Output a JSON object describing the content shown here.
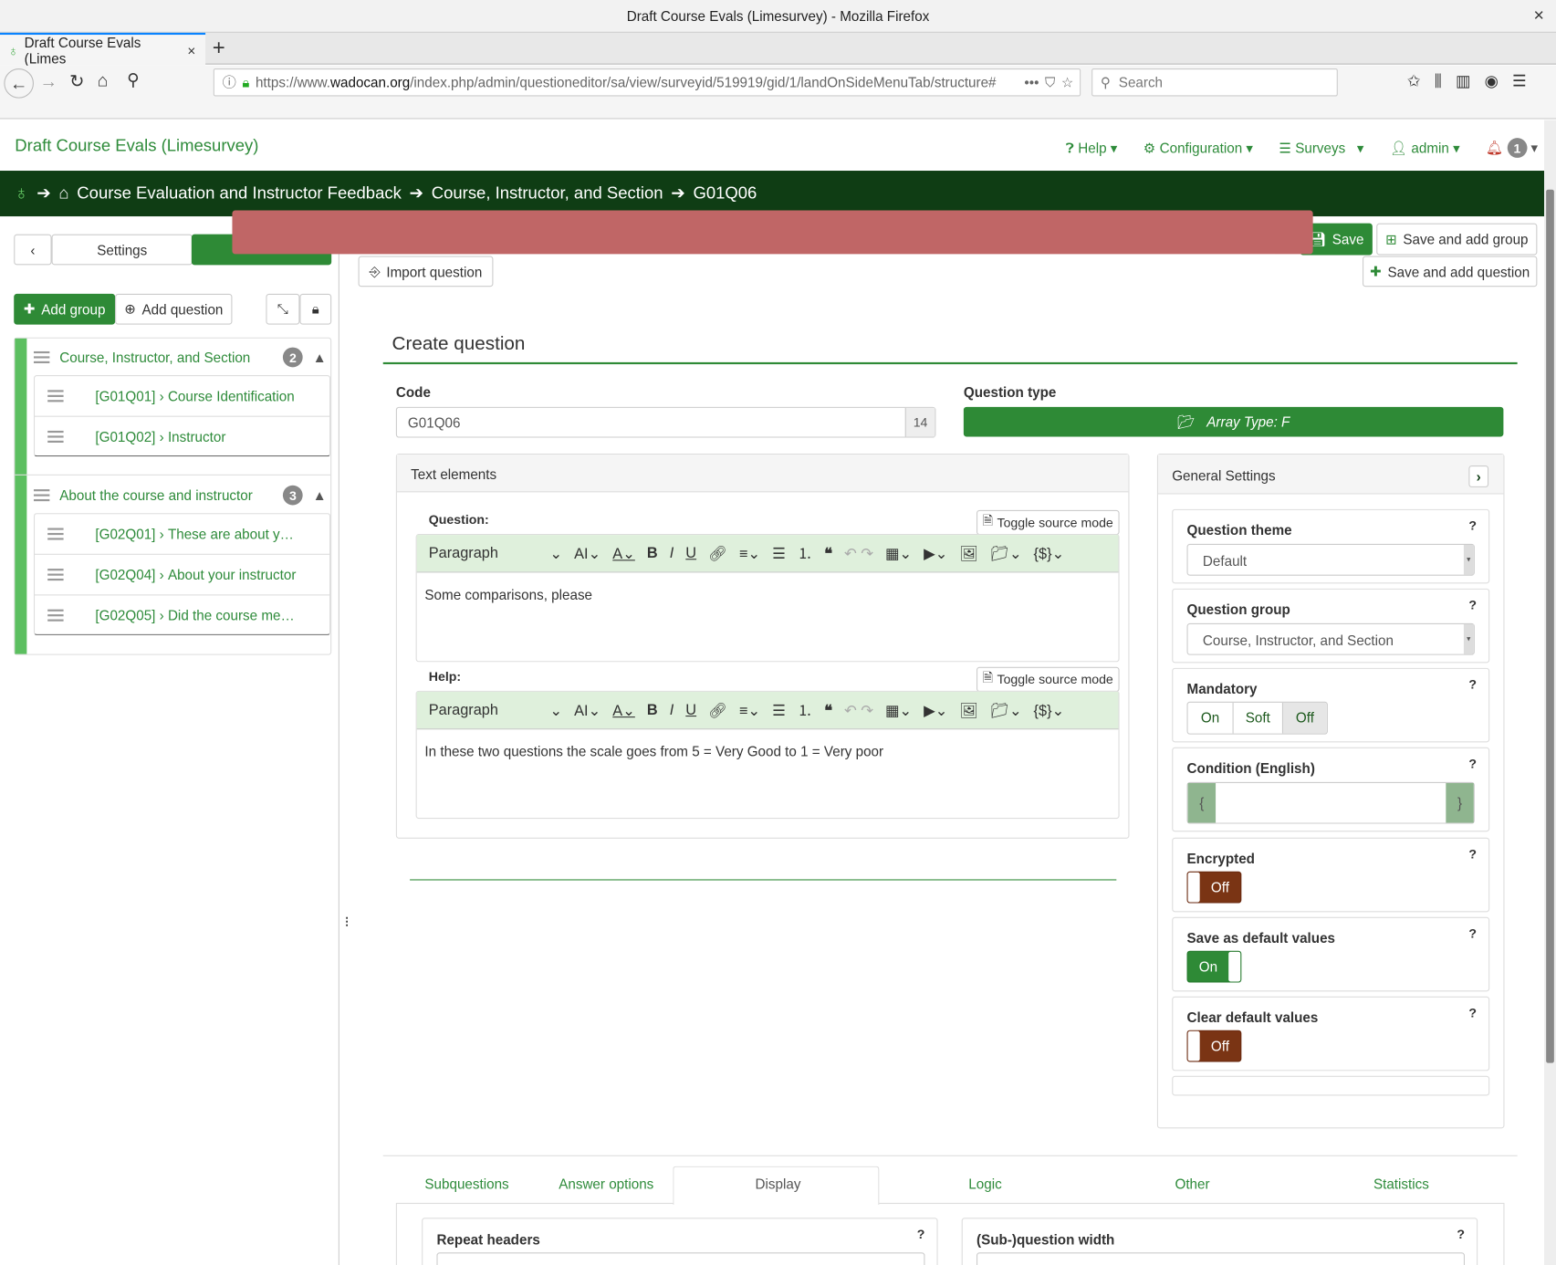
{
  "window": {
    "title": "Draft Course Evals (Limesurvey) - Mozilla Firefox",
    "close": "×"
  },
  "browser": {
    "tab_label": "Draft Course Evals (Limes",
    "tab_close": "×",
    "new_tab": "+",
    "url_prefix": "https://www.",
    "url_domain": "wadocan.org",
    "url_path": "/index.php/admin/questioneditor/sa/view/surveyid/519919/gid/1/landOnSideMenuTab/structure#",
    "url_more": "•••",
    "search_placeholder": "Search"
  },
  "app": {
    "title": "Draft Course Evals (Limesurvey)",
    "menu": {
      "help": "Help",
      "configuration": "Configuration",
      "surveys": "Surveys",
      "admin": "admin",
      "notifications": "1"
    }
  },
  "breadcrumb": [
    "Course Evaluation and Instructor Feedback",
    "Course, Instructor, and Section",
    "G01Q06"
  ],
  "sidebar": {
    "settings_tab": "Settings",
    "add_group": "Add group",
    "add_question": "Add question",
    "groups": [
      {
        "name": "Course, Instructor, and Section",
        "count": "2",
        "questions": [
          {
            "code": "[G01Q01]",
            "title": "Course Identification"
          },
          {
            "code": "[G01Q02]",
            "title": "Instructor"
          }
        ]
      },
      {
        "name": "About the course and instructor",
        "count": "3",
        "questions": [
          {
            "code": "[G02Q01]",
            "title": "These are about y…"
          },
          {
            "code": "[G02Q04]",
            "title": "About your instructor"
          },
          {
            "code": "[G02Q05]",
            "title": "Did the course me…"
          }
        ]
      }
    ]
  },
  "toolbar": {
    "import_question": "Import question",
    "save": "Save",
    "save_add_group": "Save and add group",
    "save_add_question": "Save and add question"
  },
  "editor": {
    "heading": "Create question",
    "code_label": "Code",
    "code_value": "G01Q06",
    "code_counter": "14",
    "type_label": "Question type",
    "type_value": "Array Type: F",
    "text_elements": "Text elements",
    "question_label": "Question:",
    "help_label": "Help:",
    "toggle_source": "Toggle source mode",
    "paragraph": "Paragraph",
    "question_text": "Some comparisons, please",
    "help_text": "In these two questions the scale goes from 5 = Very Good to 1 = Very poor"
  },
  "general": {
    "title": "General Settings",
    "theme_label": "Question theme",
    "theme_value": "Default",
    "group_label": "Question group",
    "group_value": "Course, Instructor, and Section",
    "mandatory_label": "Mandatory",
    "mandatory_options": [
      "On",
      "Soft",
      "Off"
    ],
    "mandatory_selected": "Off",
    "condition_label": "Condition (English)",
    "cond_open": "{",
    "cond_close": "}",
    "encrypted_label": "Encrypted",
    "encrypted_value": "Off",
    "save_default_label": "Save as default values",
    "save_default_value": "On",
    "clear_default_label": "Clear default values",
    "clear_default_value": "Off",
    "help_mark": "?"
  },
  "tabs": [
    "Subquestions",
    "Answer options",
    "Display",
    "Logic",
    "Other",
    "Statistics"
  ],
  "display": {
    "repeat_headers": "Repeat headers",
    "subq_width": "(Sub-)question width"
  },
  "colors": {
    "brand": "#2e8a36",
    "breadcrumb_bg": "#0f3d14",
    "off_toggle": "#7a3414"
  }
}
